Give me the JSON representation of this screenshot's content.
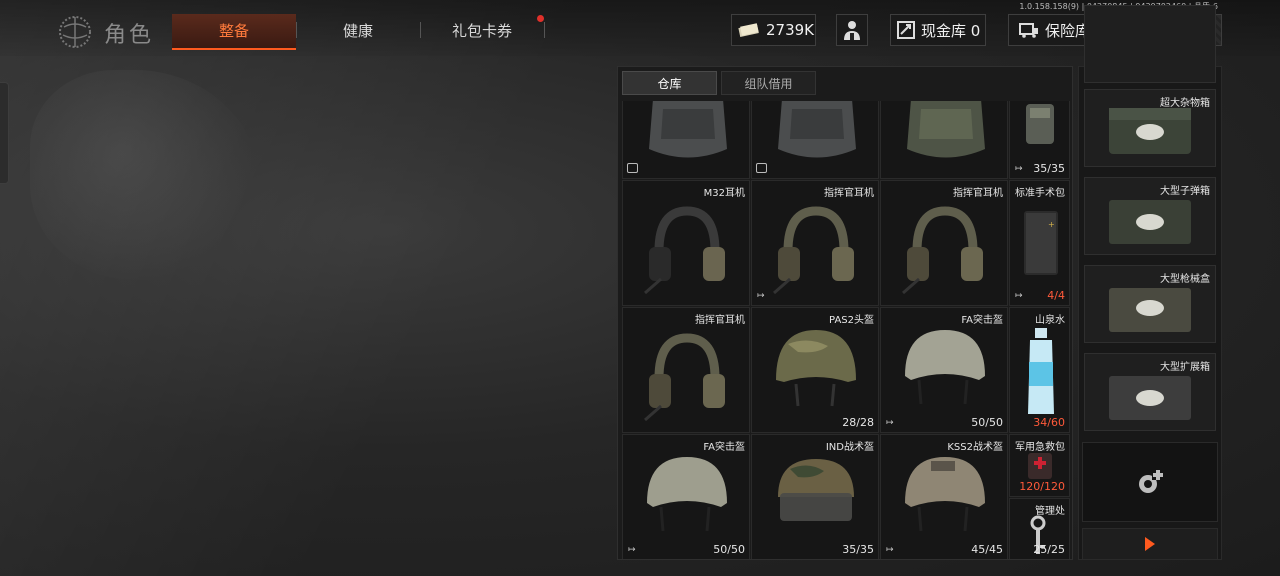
{
  "version": "1.0.158.158(9) | 04270845 | 9439702460 | 品质-6",
  "header": {
    "title": "角色",
    "tabs": [
      "整备",
      "健康",
      "礼包卡券"
    ],
    "active_tab": "整备",
    "currency": "2739K",
    "cash_vault": "现金库 0",
    "insurance": "保险库"
  },
  "storage_tabs": [
    "仓库",
    "组队借用"
  ],
  "items": [
    {
      "name": "",
      "count": "",
      "icon": "backpack"
    },
    {
      "name": "",
      "count": "",
      "icon": "backpack"
    },
    {
      "name": "",
      "count": "",
      "icon": "backpack-green"
    },
    {
      "name": "",
      "count": "35/35",
      "icon": "pouch"
    },
    {
      "name": "M32耳机",
      "count": "",
      "icon": "headset-dark"
    },
    {
      "name": "指挥官耳机",
      "count": "",
      "icon": "headset-olive"
    },
    {
      "name": "指挥官耳机",
      "count": "",
      "icon": "headset-olive"
    },
    {
      "name": "标准手术包",
      "count": "4/4",
      "icon": "surgery-kit"
    },
    {
      "name": "指挥官耳机",
      "count": "",
      "icon": "headset-olive"
    },
    {
      "name": "PAS2头盔",
      "count": "28/28",
      "icon": "helmet-camo"
    },
    {
      "name": "FA突击盔",
      "count": "50/50",
      "icon": "helmet-grey"
    },
    {
      "name": "山泉水",
      "count": "34/60",
      "icon": "water-bottle"
    },
    {
      "name": "FA突击盔",
      "count": "50/50",
      "icon": "helmet-grey"
    },
    {
      "name": "IND战术盔",
      "count": "35/35",
      "icon": "helmet-camo-visor"
    },
    {
      "name": "KSS2战术盔",
      "count": "45/45",
      "icon": "helmet-tan"
    },
    {
      "name": "军用急救包",
      "count": "120/120",
      "icon": "medkit"
    },
    {
      "name": "管理处",
      "count": "25/25",
      "icon": "key"
    }
  ],
  "containers": [
    {
      "name": "超大杂物箱"
    },
    {
      "name": "大型子弹箱"
    },
    {
      "name": "大型枪械盒"
    },
    {
      "name": "大型扩展箱"
    }
  ],
  "colors": {
    "accent": "#ff5a1f",
    "warning": "#ff5a3a",
    "panel": "#1b1b1b"
  }
}
